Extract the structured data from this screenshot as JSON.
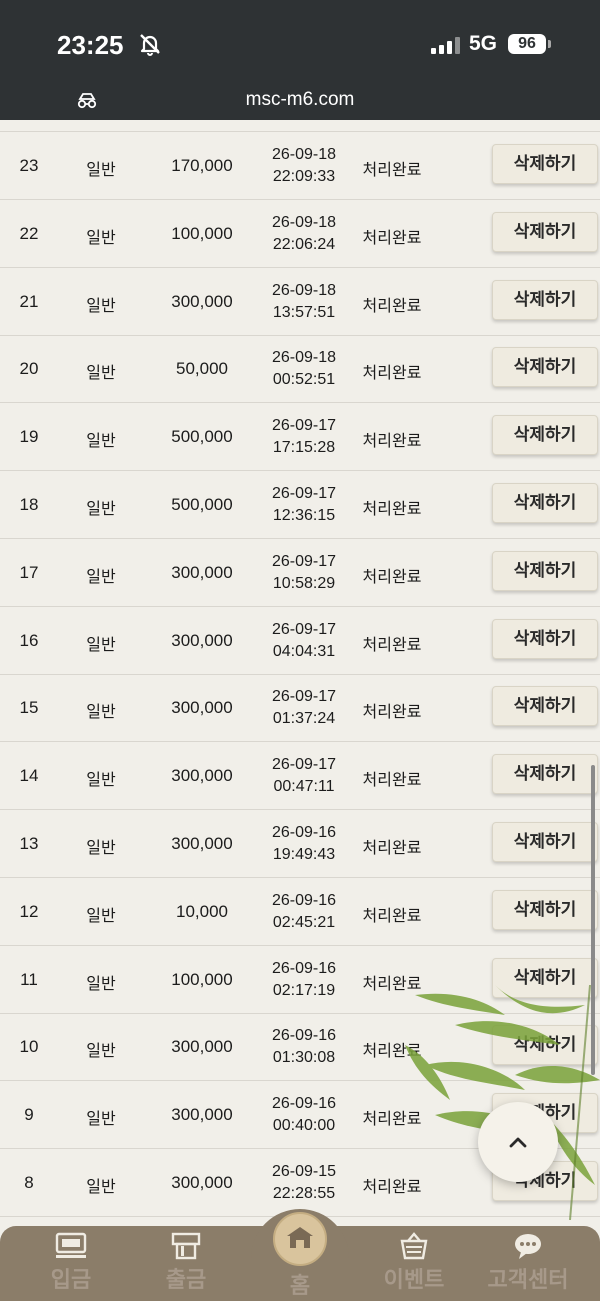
{
  "status_bar": {
    "time": "23:25",
    "network": "5G",
    "battery": "96"
  },
  "browser": {
    "url": "msc-m6.com"
  },
  "list": {
    "rows": [
      {
        "no": "23",
        "type": "일반",
        "amount": "170,000",
        "date": "26-09-18",
        "time": "22:09:33",
        "status": "처리완료",
        "action": "삭제하기"
      },
      {
        "no": "22",
        "type": "일반",
        "amount": "100,000",
        "date": "26-09-18",
        "time": "22:06:24",
        "status": "처리완료",
        "action": "삭제하기"
      },
      {
        "no": "21",
        "type": "일반",
        "amount": "300,000",
        "date": "26-09-18",
        "time": "13:57:51",
        "status": "처리완료",
        "action": "삭제하기"
      },
      {
        "no": "20",
        "type": "일반",
        "amount": "50,000",
        "date": "26-09-18",
        "time": "00:52:51",
        "status": "처리완료",
        "action": "삭제하기"
      },
      {
        "no": "19",
        "type": "일반",
        "amount": "500,000",
        "date": "26-09-17",
        "time": "17:15:28",
        "status": "처리완료",
        "action": "삭제하기"
      },
      {
        "no": "18",
        "type": "일반",
        "amount": "500,000",
        "date": "26-09-17",
        "time": "12:36:15",
        "status": "처리완료",
        "action": "삭제하기"
      },
      {
        "no": "17",
        "type": "일반",
        "amount": "300,000",
        "date": "26-09-17",
        "time": "10:58:29",
        "status": "처리완료",
        "action": "삭제하기"
      },
      {
        "no": "16",
        "type": "일반",
        "amount": "300,000",
        "date": "26-09-17",
        "time": "04:04:31",
        "status": "처리완료",
        "action": "삭제하기"
      },
      {
        "no": "15",
        "type": "일반",
        "amount": "300,000",
        "date": "26-09-17",
        "time": "01:37:24",
        "status": "처리완료",
        "action": "삭제하기"
      },
      {
        "no": "14",
        "type": "일반",
        "amount": "300,000",
        "date": "26-09-17",
        "time": "00:47:11",
        "status": "처리완료",
        "action": "삭제하기"
      },
      {
        "no": "13",
        "type": "일반",
        "amount": "300,000",
        "date": "26-09-16",
        "time": "19:49:43",
        "status": "처리완료",
        "action": "삭제하기"
      },
      {
        "no": "12",
        "type": "일반",
        "amount": "10,000",
        "date": "26-09-16",
        "time": "02:45:21",
        "status": "처리완료",
        "action": "삭제하기"
      },
      {
        "no": "11",
        "type": "일반",
        "amount": "100,000",
        "date": "26-09-16",
        "time": "02:17:19",
        "status": "처리완료",
        "action": "삭제하기"
      },
      {
        "no": "10",
        "type": "일반",
        "amount": "300,000",
        "date": "26-09-16",
        "time": "01:30:08",
        "status": "처리완료",
        "action": "삭제하기"
      },
      {
        "no": "9",
        "type": "일반",
        "amount": "300,000",
        "date": "26-09-16",
        "time": "00:40:00",
        "status": "처리완료",
        "action": "삭제하기"
      },
      {
        "no": "8",
        "type": "일반",
        "amount": "300,000",
        "date": "26-09-15",
        "time": "22:28:55",
        "status": "처리완료",
        "action": "삭제하기"
      }
    ]
  },
  "scroll_top": {
    "icon": "chevron-up-icon",
    "glyph": "⌃"
  },
  "bottom_nav": {
    "items": [
      {
        "label": "입금",
        "icon": "cash-icon"
      },
      {
        "label": "출금",
        "icon": "atm-icon"
      },
      {
        "label": "홈",
        "icon": "house-icon"
      },
      {
        "label": "이벤트",
        "icon": "basket-icon"
      },
      {
        "label": "고객센터",
        "icon": "chat-icon"
      }
    ]
  }
}
